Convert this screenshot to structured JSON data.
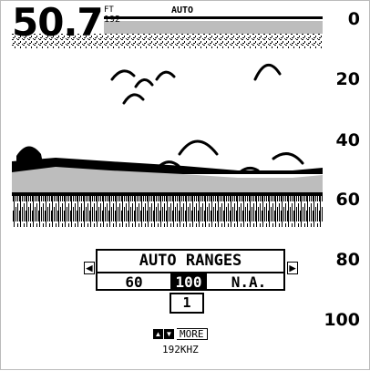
{
  "header": {
    "depth_value": "50.7",
    "depth_unit": "FT",
    "frequency_code": "192",
    "range_mode": "AUTO"
  },
  "depth_scale": {
    "labels": [
      "0",
      "20",
      "40",
      "60",
      "80",
      "100"
    ]
  },
  "ranges_menu": {
    "title": "AUTO RANGES",
    "options": [
      "60",
      "100",
      "N.A."
    ],
    "selected_option": "100",
    "sub_value": "1"
  },
  "footer": {
    "more_label": "MORE",
    "frequency": "192KHZ"
  },
  "icons": {
    "left_arrow": "left-arrow-icon",
    "right_arrow": "right-arrow-icon",
    "up_key": "up-arrow-icon",
    "down_key": "down-arrow-icon"
  }
}
